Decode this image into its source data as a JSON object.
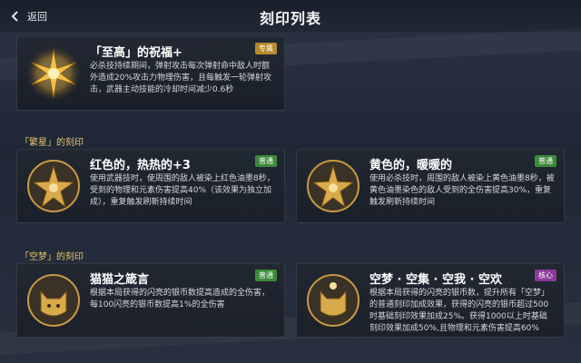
{
  "header": {
    "back_label": "返回",
    "title": "刻印列表"
  },
  "top_card": {
    "title": "「至高」的祝福+",
    "badge": "专属",
    "desc": "必杀技持续期间，弹射攻击每次弹射命中敌人时额外造成20%攻击力物理伤害，且每触发一轮弹射攻击，武器主动技能的冷却时间减少0.6秒"
  },
  "section_1": {
    "title": "「繁星」的刻印",
    "cards": [
      {
        "title": "红色的，热热的+3",
        "badge": "普通",
        "desc": "使用武器技时，使周围的敌人被染上红色油墨8秒，受到的物理和元素伤害提高40%（该效果为独立加成），重复触发刷新持续时间"
      },
      {
        "title": "黄色的，暖暖的",
        "badge": "普通",
        "desc": "使用必杀技时，周围的敌人被染上黄色油墨8秒，被黄色油墨染色的敌人受到的全伤害提高30%，重复触发刷新持续时间"
      }
    ]
  },
  "section_2": {
    "title": "「空梦」的刻印",
    "cards": [
      {
        "title": "猫猫之箴言",
        "badge": "普通",
        "desc": "根据本局获得的闪亮的银币数提高造成的全伤害，每100闪亮的银币数提高1%的全伤害"
      },
      {
        "title": "空梦 · 空集 · 空我 · 空欢",
        "badge": "核心",
        "desc": "根据本局获得的闪亮的银币数，提升所有「空梦」的普通刻印加成效果，获得的闪亮的银币超过500时基础刻印效果加成25%。获得1000以上时基础刻印效果加成50%,且物理和元素伤害提高60%"
      }
    ]
  },
  "colors": {
    "accent_gold": "#e8c46a",
    "badge_exclusive": "#b98a2b",
    "badge_normal": "#3d8a3a",
    "badge_core": "#8b3a9c"
  },
  "icons": {
    "back": "back-arrow-icon",
    "supreme_blessing": "starburst-emblem-icon",
    "star_emblem": "star-emblem-icon",
    "cat_emblem": "cat-emblem-icon",
    "dream_emblem": "dream-emblem-icon"
  }
}
